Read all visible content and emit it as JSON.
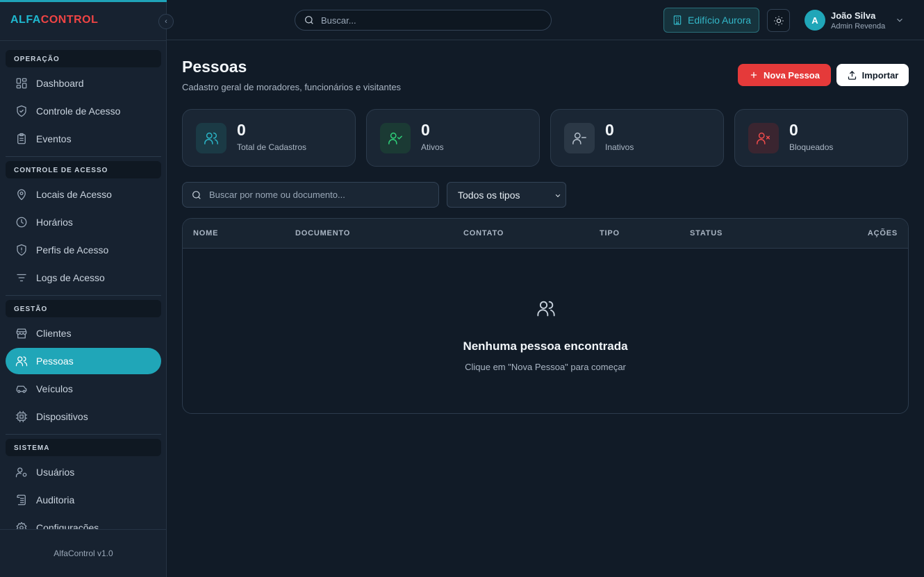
{
  "brand": {
    "alfa": "ALFA",
    "control": "CONTROL",
    "version": "AlfaControl v1.0"
  },
  "sidebar": {
    "sections": [
      {
        "label": "OPERAÇÃO",
        "items": [
          {
            "label": "Dashboard",
            "icon": "dashboard-icon"
          },
          {
            "label": "Controle de Acesso",
            "icon": "shield-check-icon"
          },
          {
            "label": "Eventos",
            "icon": "clipboard-icon"
          }
        ]
      },
      {
        "label": "CONTROLE DE ACESSO",
        "items": [
          {
            "label": "Locais de Acesso",
            "icon": "map-pin-icon"
          },
          {
            "label": "Horários",
            "icon": "clock-icon"
          },
          {
            "label": "Perfis de Acesso",
            "icon": "shield-alert-icon"
          },
          {
            "label": "Logs de Acesso",
            "icon": "filter-icon"
          }
        ]
      },
      {
        "label": "GESTÃO",
        "items": [
          {
            "label": "Clientes",
            "icon": "store-icon"
          },
          {
            "label": "Pessoas",
            "icon": "users-icon",
            "active": true
          },
          {
            "label": "Veículos",
            "icon": "car-icon"
          },
          {
            "label": "Dispositivos",
            "icon": "cpu-icon"
          }
        ]
      },
      {
        "label": "SISTEMA",
        "items": [
          {
            "label": "Usuários",
            "icon": "user-cog-icon"
          },
          {
            "label": "Auditoria",
            "icon": "log-icon"
          },
          {
            "label": "Configurações",
            "icon": "settings-icon"
          }
        ]
      }
    ]
  },
  "header": {
    "search_placeholder": "Buscar...",
    "building": "Edifício Aurora",
    "user": {
      "initial": "A",
      "name": "João Silva",
      "role": "Admin Revenda"
    }
  },
  "page": {
    "title": "Pessoas",
    "subtitle": "Cadastro geral de moradores, funcionários e visitantes",
    "new_button": "Nova Pessoa",
    "import_button": "Importar"
  },
  "stats": [
    {
      "value": "0",
      "label": "Total de Cadastros",
      "color": "#2bb4c6",
      "bg": "#1b3a45"
    },
    {
      "value": "0",
      "label": "Ativos",
      "color": "#2fd17a",
      "bg": "#1b3a34"
    },
    {
      "value": "0",
      "label": "Inativos",
      "color": "#b6c1cd",
      "bg": "#2b3846"
    },
    {
      "value": "0",
      "label": "Bloqueados",
      "color": "#ef4b4b",
      "bg": "#3a2530"
    }
  ],
  "filters": {
    "search_placeholder": "Buscar por nome ou documento...",
    "type_selected": "Todos os tipos"
  },
  "table": {
    "columns": [
      "NOME",
      "DOCUMENTO",
      "CONTATO",
      "TIPO",
      "STATUS",
      "AÇÕES"
    ],
    "empty_title": "Nenhuma pessoa encontrada",
    "empty_subtitle": "Clique em \"Nova Pessoa\" para começar"
  }
}
